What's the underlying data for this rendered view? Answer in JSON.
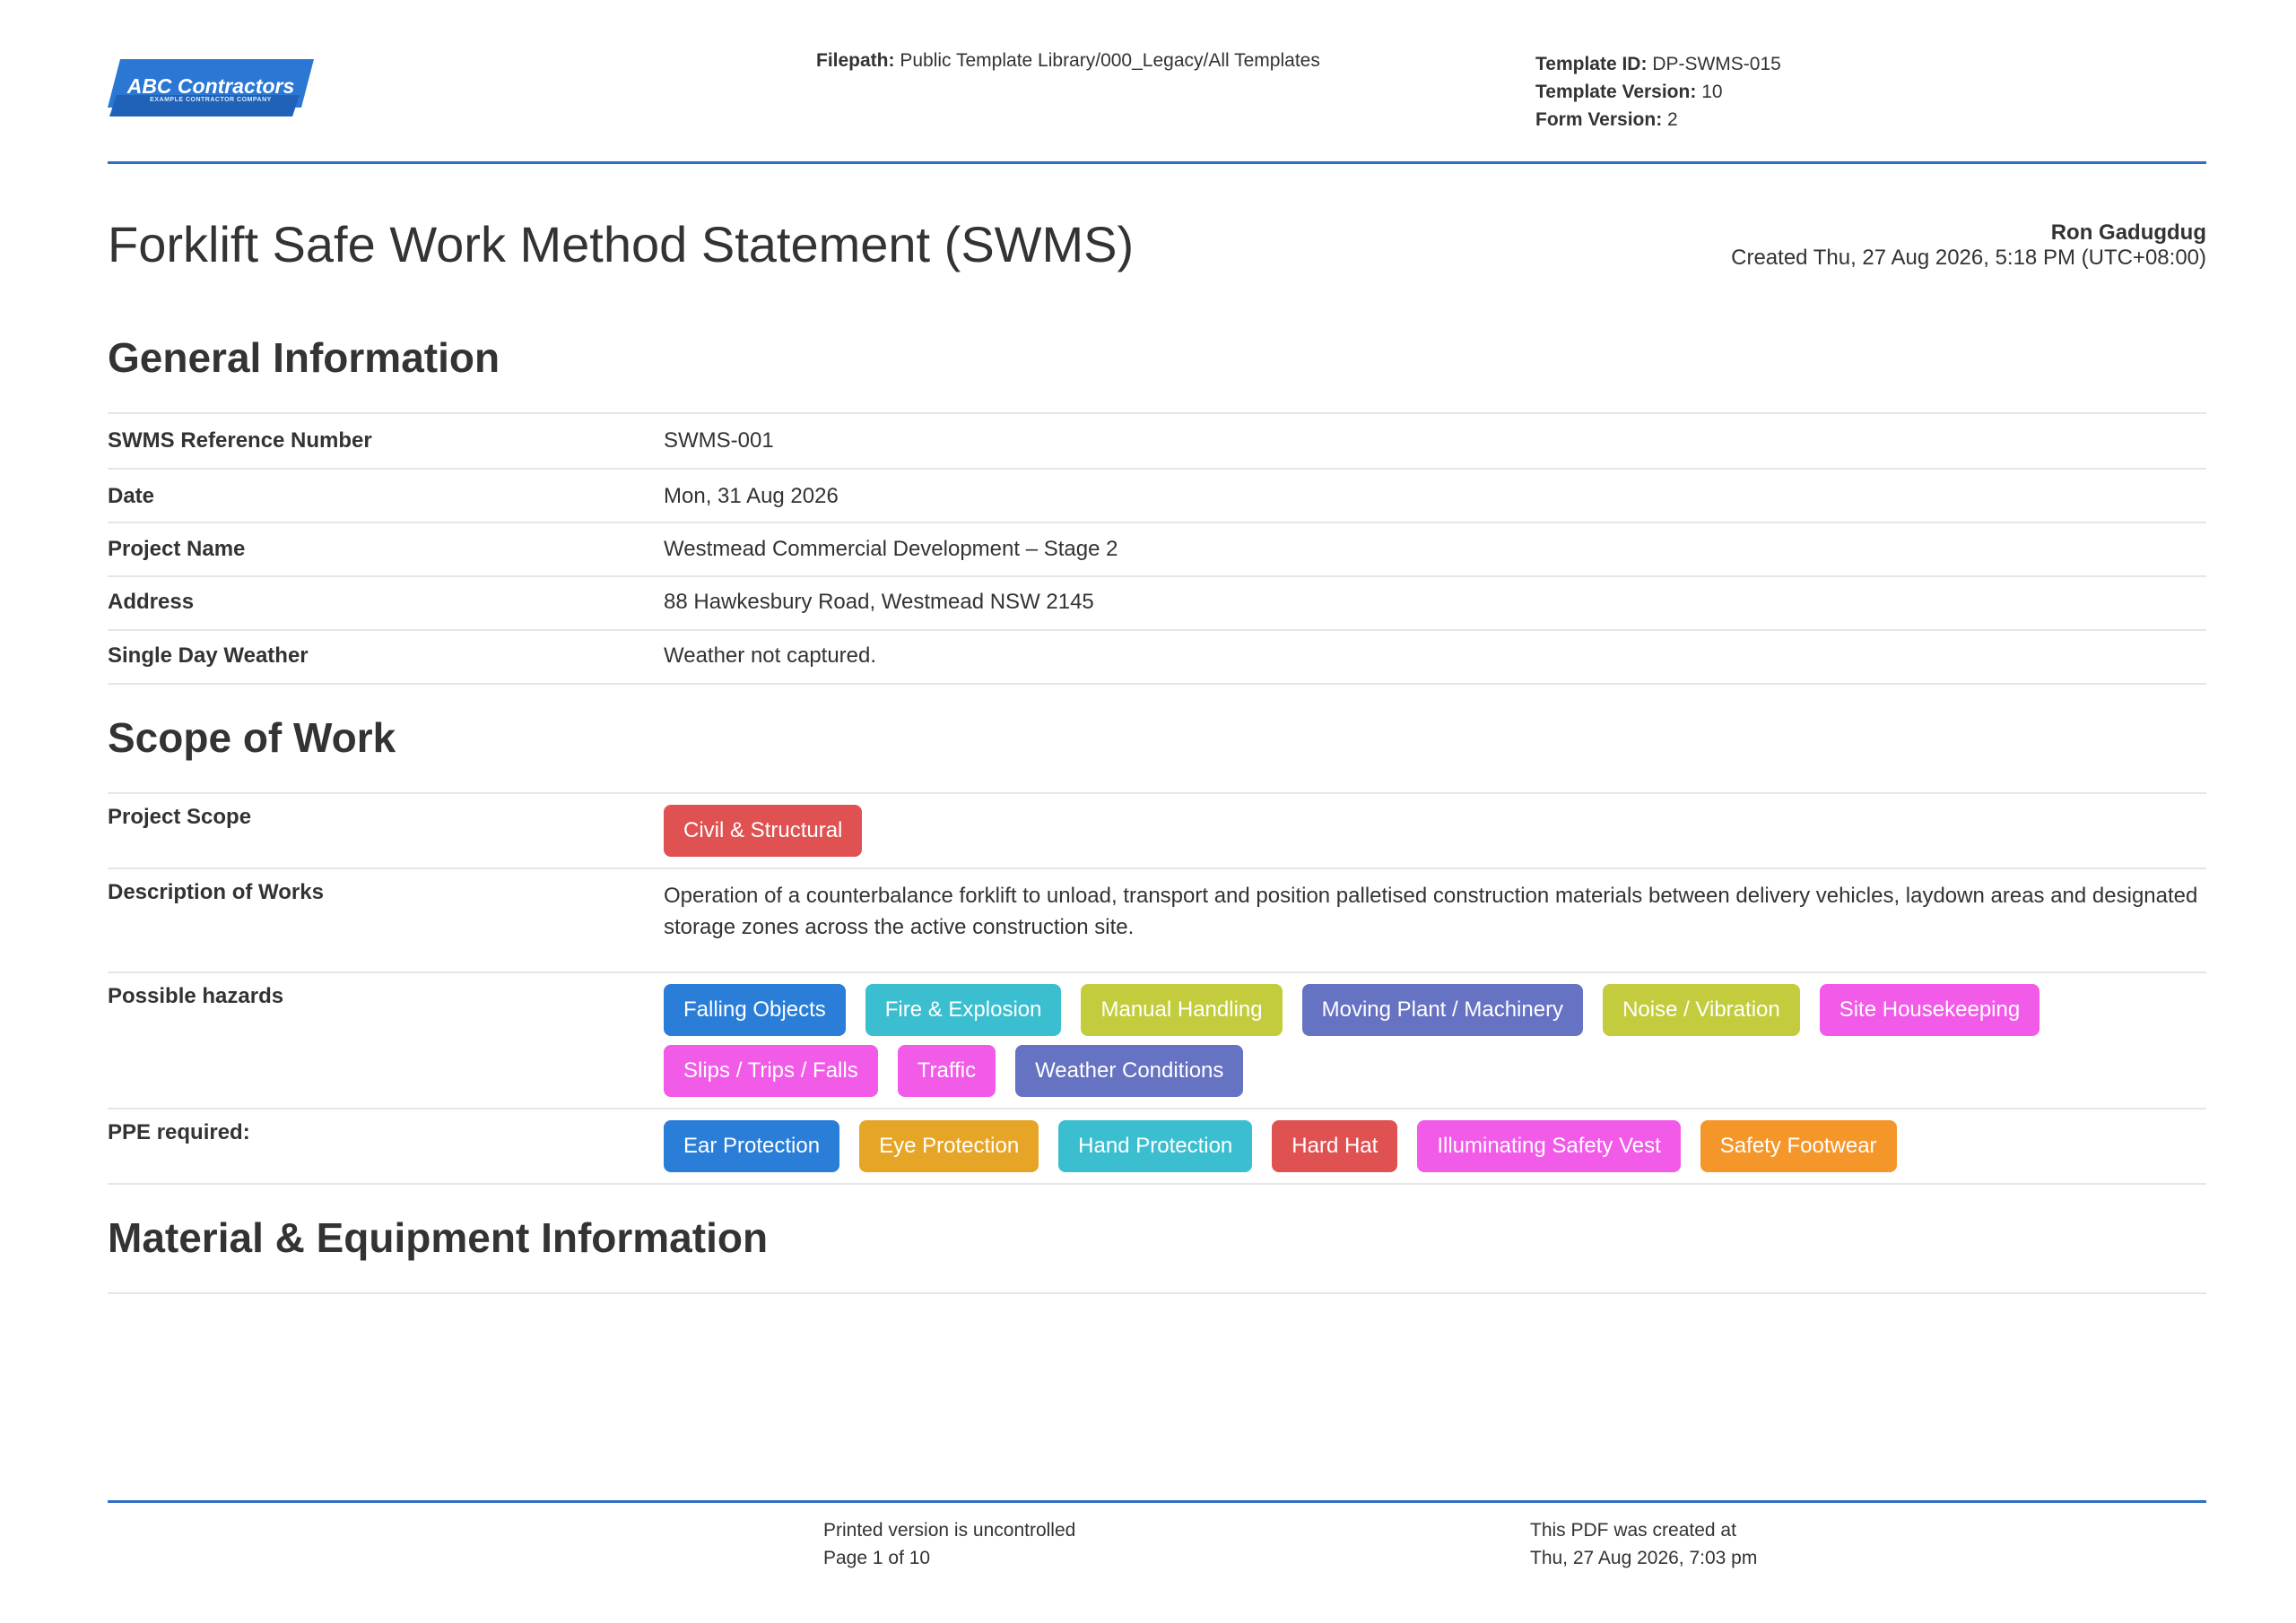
{
  "header": {
    "logo": {
      "name": "ABC Contractors",
      "tagline": "EXAMPLE CONTRACTOR COMPANY",
      "color": "#2a77d4"
    },
    "filepath_label": "Filepath:",
    "filepath_value": "Public Template Library/000_Legacy/All Templates",
    "template_id_label": "Template ID:",
    "template_id_value": "DP-SWMS-015",
    "template_version_label": "Template Version:",
    "template_version_value": "10",
    "form_version_label": "Form Version:",
    "form_version_value": "2"
  },
  "document": {
    "title": "Forklift Safe Work Method Statement (SWMS)",
    "author": "Ron Gadugdug",
    "created": "Created Thu, 27 Aug 2026, 5:18 PM (UTC+08:00)"
  },
  "general": {
    "heading": "General Information",
    "rows": [
      {
        "label": "SWMS Reference Number",
        "value": "SWMS-001"
      },
      {
        "label": "Date",
        "value": "Mon, 31 Aug 2026"
      },
      {
        "label": "Project Name",
        "value": "Westmead Commercial Development – Stage 2"
      },
      {
        "label": "Address",
        "value": "88 Hawkesbury Road, Westmead NSW 2145"
      },
      {
        "label": "Single Day Weather",
        "value": "Weather not captured."
      }
    ]
  },
  "scope": {
    "heading": "Scope of Work",
    "project_scope_label": "Project Scope",
    "project_scope_tags": [
      {
        "text": "Civil & Structural",
        "color": "#e05252"
      }
    ],
    "description_label": "Description of Works",
    "description_value": "Operation of a counterbalance forklift to unload, transport and position palletised construction materials between delivery vehicles, laydown areas and designated storage zones across the active construction site.",
    "hazards_label": "Possible hazards",
    "hazards": [
      {
        "text": "Falling Objects",
        "color": "#2a7ed8"
      },
      {
        "text": "Fire & Explosion",
        "color": "#3bbfd0"
      },
      {
        "text": "Manual Handling",
        "color": "#c3cc3d"
      },
      {
        "text": "Moving Plant / Machinery",
        "color": "#6672c2"
      },
      {
        "text": "Noise / Vibration",
        "color": "#c3cc3d"
      },
      {
        "text": "Site Housekeeping",
        "color": "#f25ae8"
      },
      {
        "text": "Slips / Trips / Falls",
        "color": "#f25ae8"
      },
      {
        "text": "Traffic",
        "color": "#f25ae8"
      },
      {
        "text": "Weather Conditions",
        "color": "#6672c2"
      }
    ],
    "ppe_label": "PPE required:",
    "ppe": [
      {
        "text": "Ear Protection",
        "color": "#2a7ed8"
      },
      {
        "text": "Eye Protection",
        "color": "#e6a526"
      },
      {
        "text": "Hand Protection",
        "color": "#3bbfd0"
      },
      {
        "text": "Hard Hat",
        "color": "#e05252"
      },
      {
        "text": "Illuminating Safety Vest",
        "color": "#f25ae8"
      },
      {
        "text": "Safety Footwear",
        "color": "#f5962a"
      }
    ]
  },
  "materials": {
    "heading": "Material & Equipment Information"
  },
  "footer": {
    "uncontrolled": "Printed version is uncontrolled",
    "page": "Page 1 of 10",
    "created_label": "This PDF was created at",
    "created_value": "Thu, 27 Aug 2026, 7:03 pm"
  }
}
